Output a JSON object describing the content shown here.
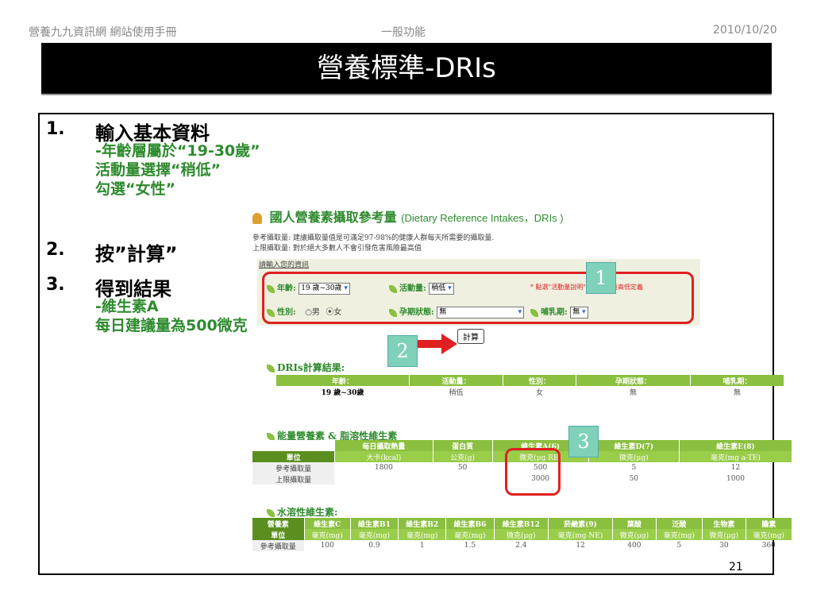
{
  "header": {
    "left": "營養九九資訊網 網站使用手冊",
    "center": "一般功能",
    "right": "2010/10/20"
  },
  "title": "營養標準-DRIs",
  "steps": [
    {
      "num": "1.",
      "head": "輸入基本資料",
      "sub": [
        "-年齡層屬於“19-30歲”",
        " 活動量選擇“稍低”",
        " 勾選“女性”"
      ]
    },
    {
      "num": "2.",
      "head": "按”計算”",
      "sub": []
    },
    {
      "num": "3.",
      "head": "得到結果",
      "sub": [
        "-維生素A",
        "每日建議量為500微克"
      ]
    }
  ],
  "app": {
    "title": "國人營養素攝取參考量",
    "title_en": "(Dietary Reference Intakes，DRIs )",
    "note1": "參考攝取量: 建議攝取量值是可滿足97-98%的健康人群每天所需要的攝取量.",
    "note2": "上限攝取量: 對於絕大多數人不會引發危害風險最高值",
    "form_header": "請輸入您的資訊",
    "age_label": "年齡:",
    "age_value": "19 歲~30歲",
    "activity_label": "活動量:",
    "activity_value": "稍低",
    "hint": "* 點選\"活動量說明\"查看活動量高低定義",
    "sex_label": "性別:",
    "sex_male": "男",
    "sex_female": "女",
    "preg_label": "孕期狀態:",
    "preg_value": "無",
    "lact_label": "哺乳期:",
    "lact_value": "無",
    "calc_button": "計算",
    "badges": [
      "1",
      "2",
      "3"
    ],
    "result_title": "DRIs計算結果:",
    "result_headers": [
      "年齡：",
      "活動量：",
      "性別：",
      "孕期狀態：",
      "哺乳期："
    ],
    "result_values": [
      "19 歲~30歲",
      "稍低",
      "女",
      "無",
      "無"
    ],
    "energy_title": "能量營養素 & 脂溶性維生素",
    "energy_headers": [
      "",
      "每日攝取熱量",
      "蛋白質",
      "維生素A(6)",
      "維生素D(7)",
      "維生素E(8)"
    ],
    "energy_units": [
      "單位",
      "大卡(kcal)",
      "公克(g)",
      "微克(μg RE)",
      "微克(μg)",
      "毫克(mg a-TE)"
    ],
    "energy_rows": [
      [
        "參考攝取量",
        "1800",
        "50",
        "500",
        "5",
        "12"
      ],
      [
        "上限攝取量",
        "",
        "",
        "3000",
        "50",
        "1000"
      ]
    ],
    "water_title": "水溶性維生素:",
    "water_headers": [
      "營養素",
      "維生素C",
      "維生素B1",
      "維生素B2",
      "維生素B6",
      "維生素B12",
      "菸鹼素(9)",
      "葉酸",
      "泛酸",
      "生物素",
      "膽素"
    ],
    "water_units": [
      "單位",
      "毫克(mg)",
      "毫克(mg)",
      "毫克(mg)",
      "毫克(mg)",
      "微克(μg)",
      "毫克(mg NE)",
      "微克(μg)",
      "毫克(mg)",
      "微克(μg)",
      "毫克(mg)"
    ],
    "water_rows": [
      [
        "參考攝取量",
        "100",
        "0.9",
        "1",
        "1.5",
        "2.4",
        "12",
        "400",
        "5",
        "30",
        "360"
      ]
    ]
  },
  "page_number": "21"
}
